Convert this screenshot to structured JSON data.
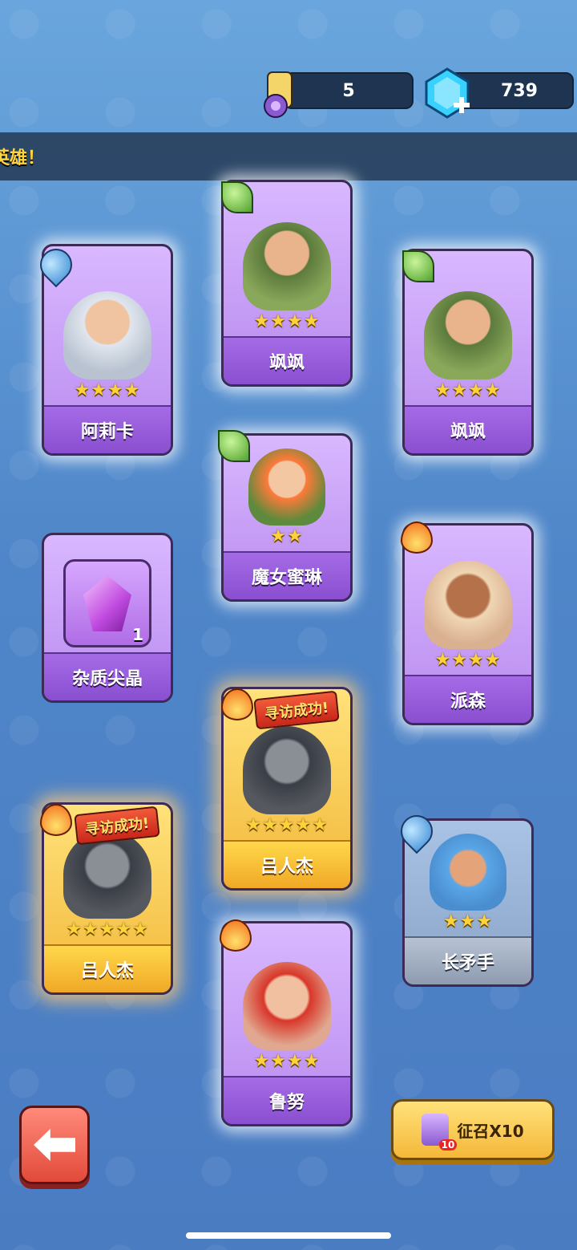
{
  "currency": {
    "scrolls": "5",
    "gems": "739"
  },
  "banner": {
    "text": "英雄！"
  },
  "cards": [
    {
      "name": "阿莉卡",
      "stars": "★★★★",
      "element": "water"
    },
    {
      "name": "飒飒",
      "stars": "★★★★",
      "element": "leaf"
    },
    {
      "name": "飒飒",
      "stars": "★★★★",
      "element": "leaf"
    },
    {
      "name": "魔女蜜琳",
      "stars": "★★",
      "element": "leaf"
    },
    {
      "name": "杂质尖晶",
      "count": "1"
    },
    {
      "name": "派森",
      "stars": "★★★★",
      "element": "fire"
    },
    {
      "name": "吕人杰",
      "stars": "★★★★★",
      "element": "fire",
      "ribbon": "寻访成功!"
    },
    {
      "name": "吕人杰",
      "stars": "★★★★★",
      "element": "fire",
      "ribbon": "寻访成功!"
    },
    {
      "name": "长矛手",
      "stars": "★★★",
      "element": "water"
    },
    {
      "name": "鲁努",
      "stars": "★★★★",
      "element": "fire"
    }
  ],
  "buttons": {
    "summon_label": "征召X10",
    "summon_badge": "10"
  }
}
